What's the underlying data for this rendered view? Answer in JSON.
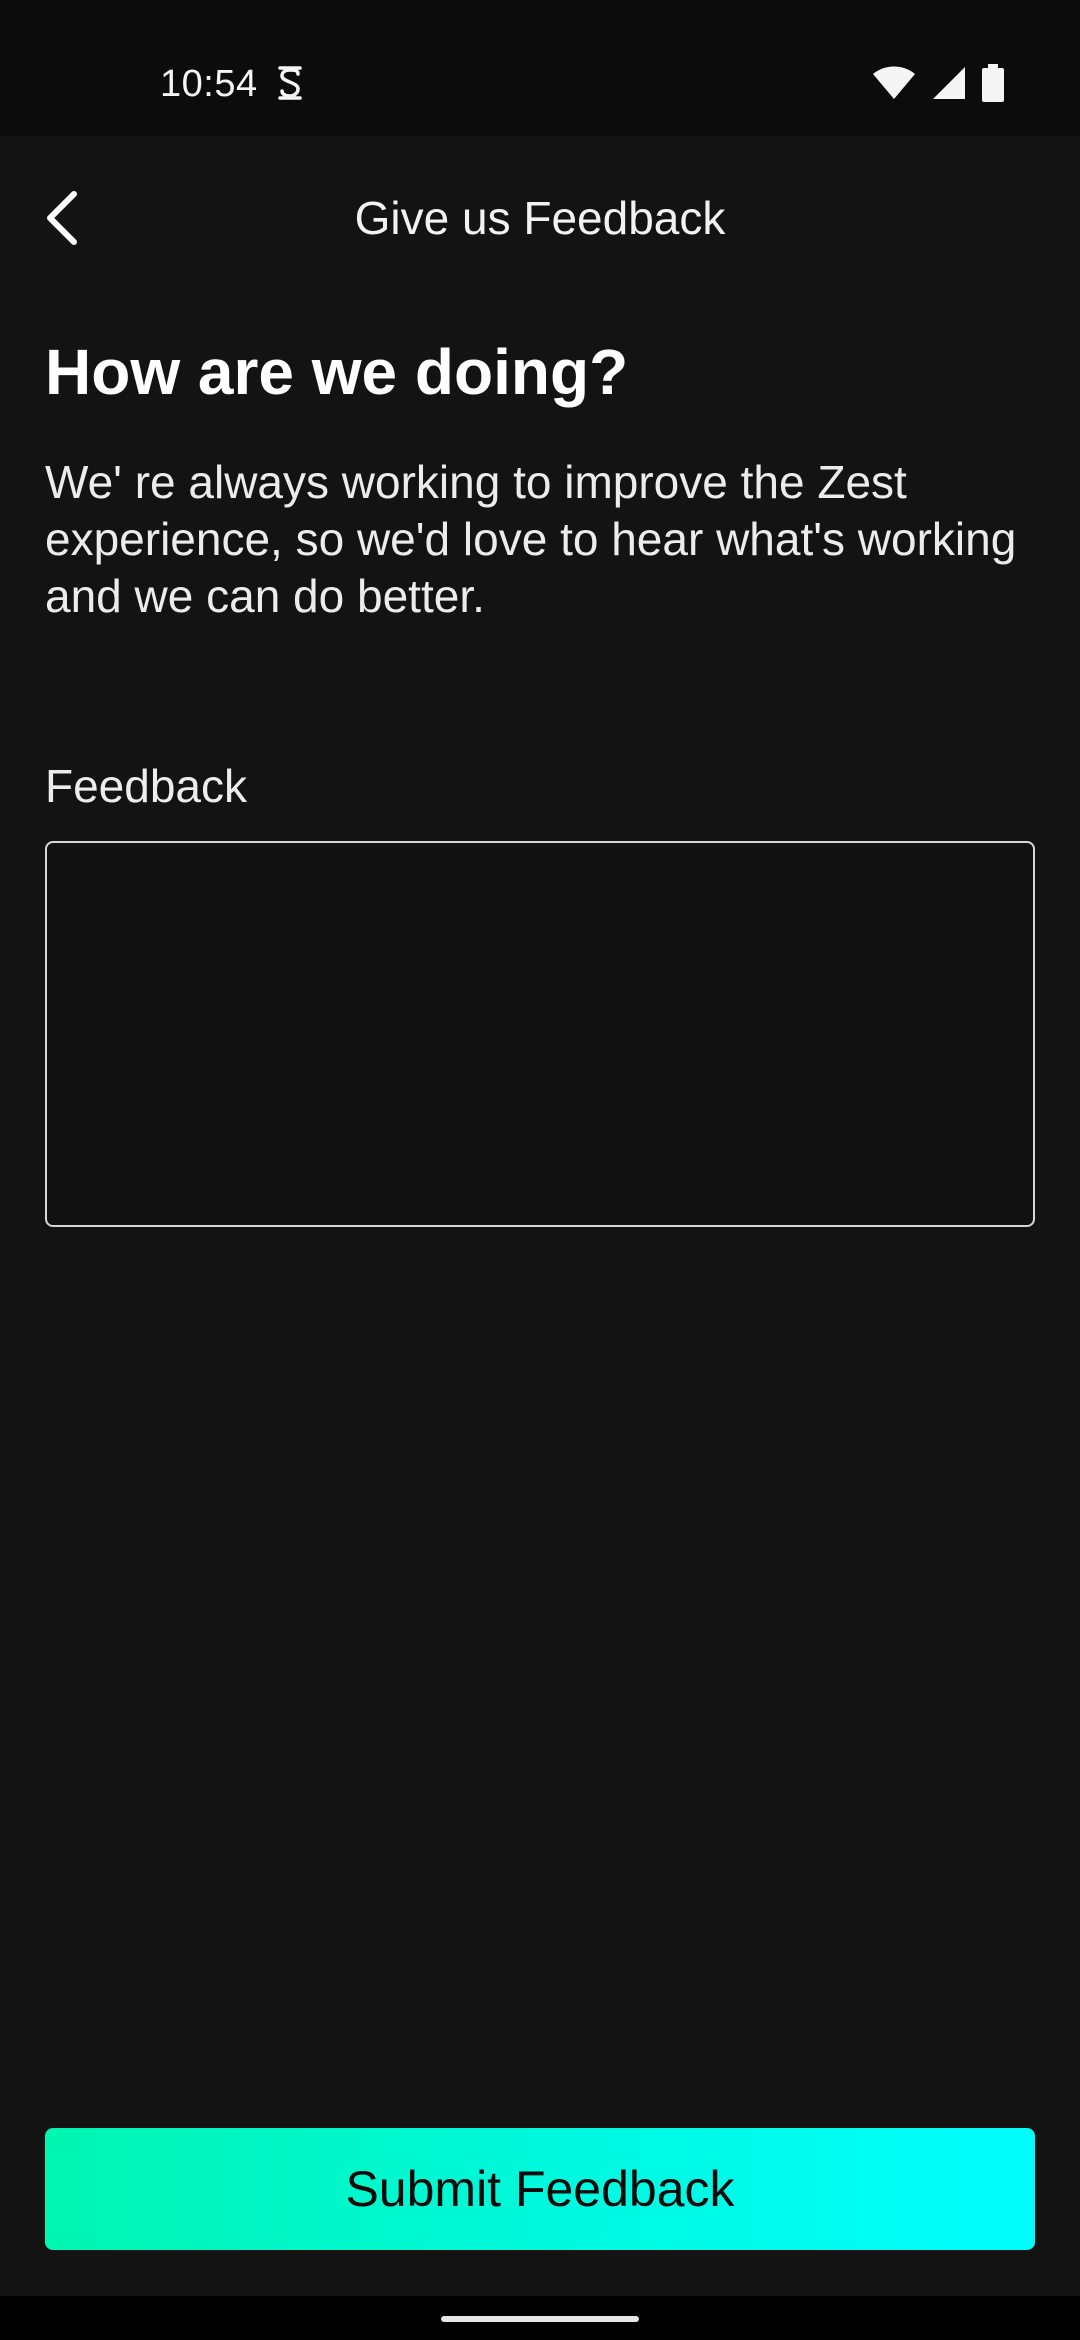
{
  "status_bar": {
    "time": "10:54",
    "left_icons": [
      "notification-s-icon"
    ],
    "right_icons": [
      "wifi-icon",
      "cell-signal-icon",
      "battery-icon"
    ]
  },
  "header": {
    "back_icon": "chevron-left-icon",
    "title": "Give us Feedback"
  },
  "main": {
    "heading": "How are we doing?",
    "description": "We' re always working to improve the Zest experience, so we'd love to hear what's working and we can do better.",
    "feedback_label": "Feedback",
    "feedback_value": "",
    "feedback_placeholder": ""
  },
  "submit": {
    "label": "Submit Feedback"
  },
  "colors": {
    "background": "#131313",
    "status_bar": "#0c0c0c",
    "accent_gradient_start": "#00f5b0",
    "accent_gradient_end": "#00fdfd",
    "field_border": "#d6d6d6"
  }
}
